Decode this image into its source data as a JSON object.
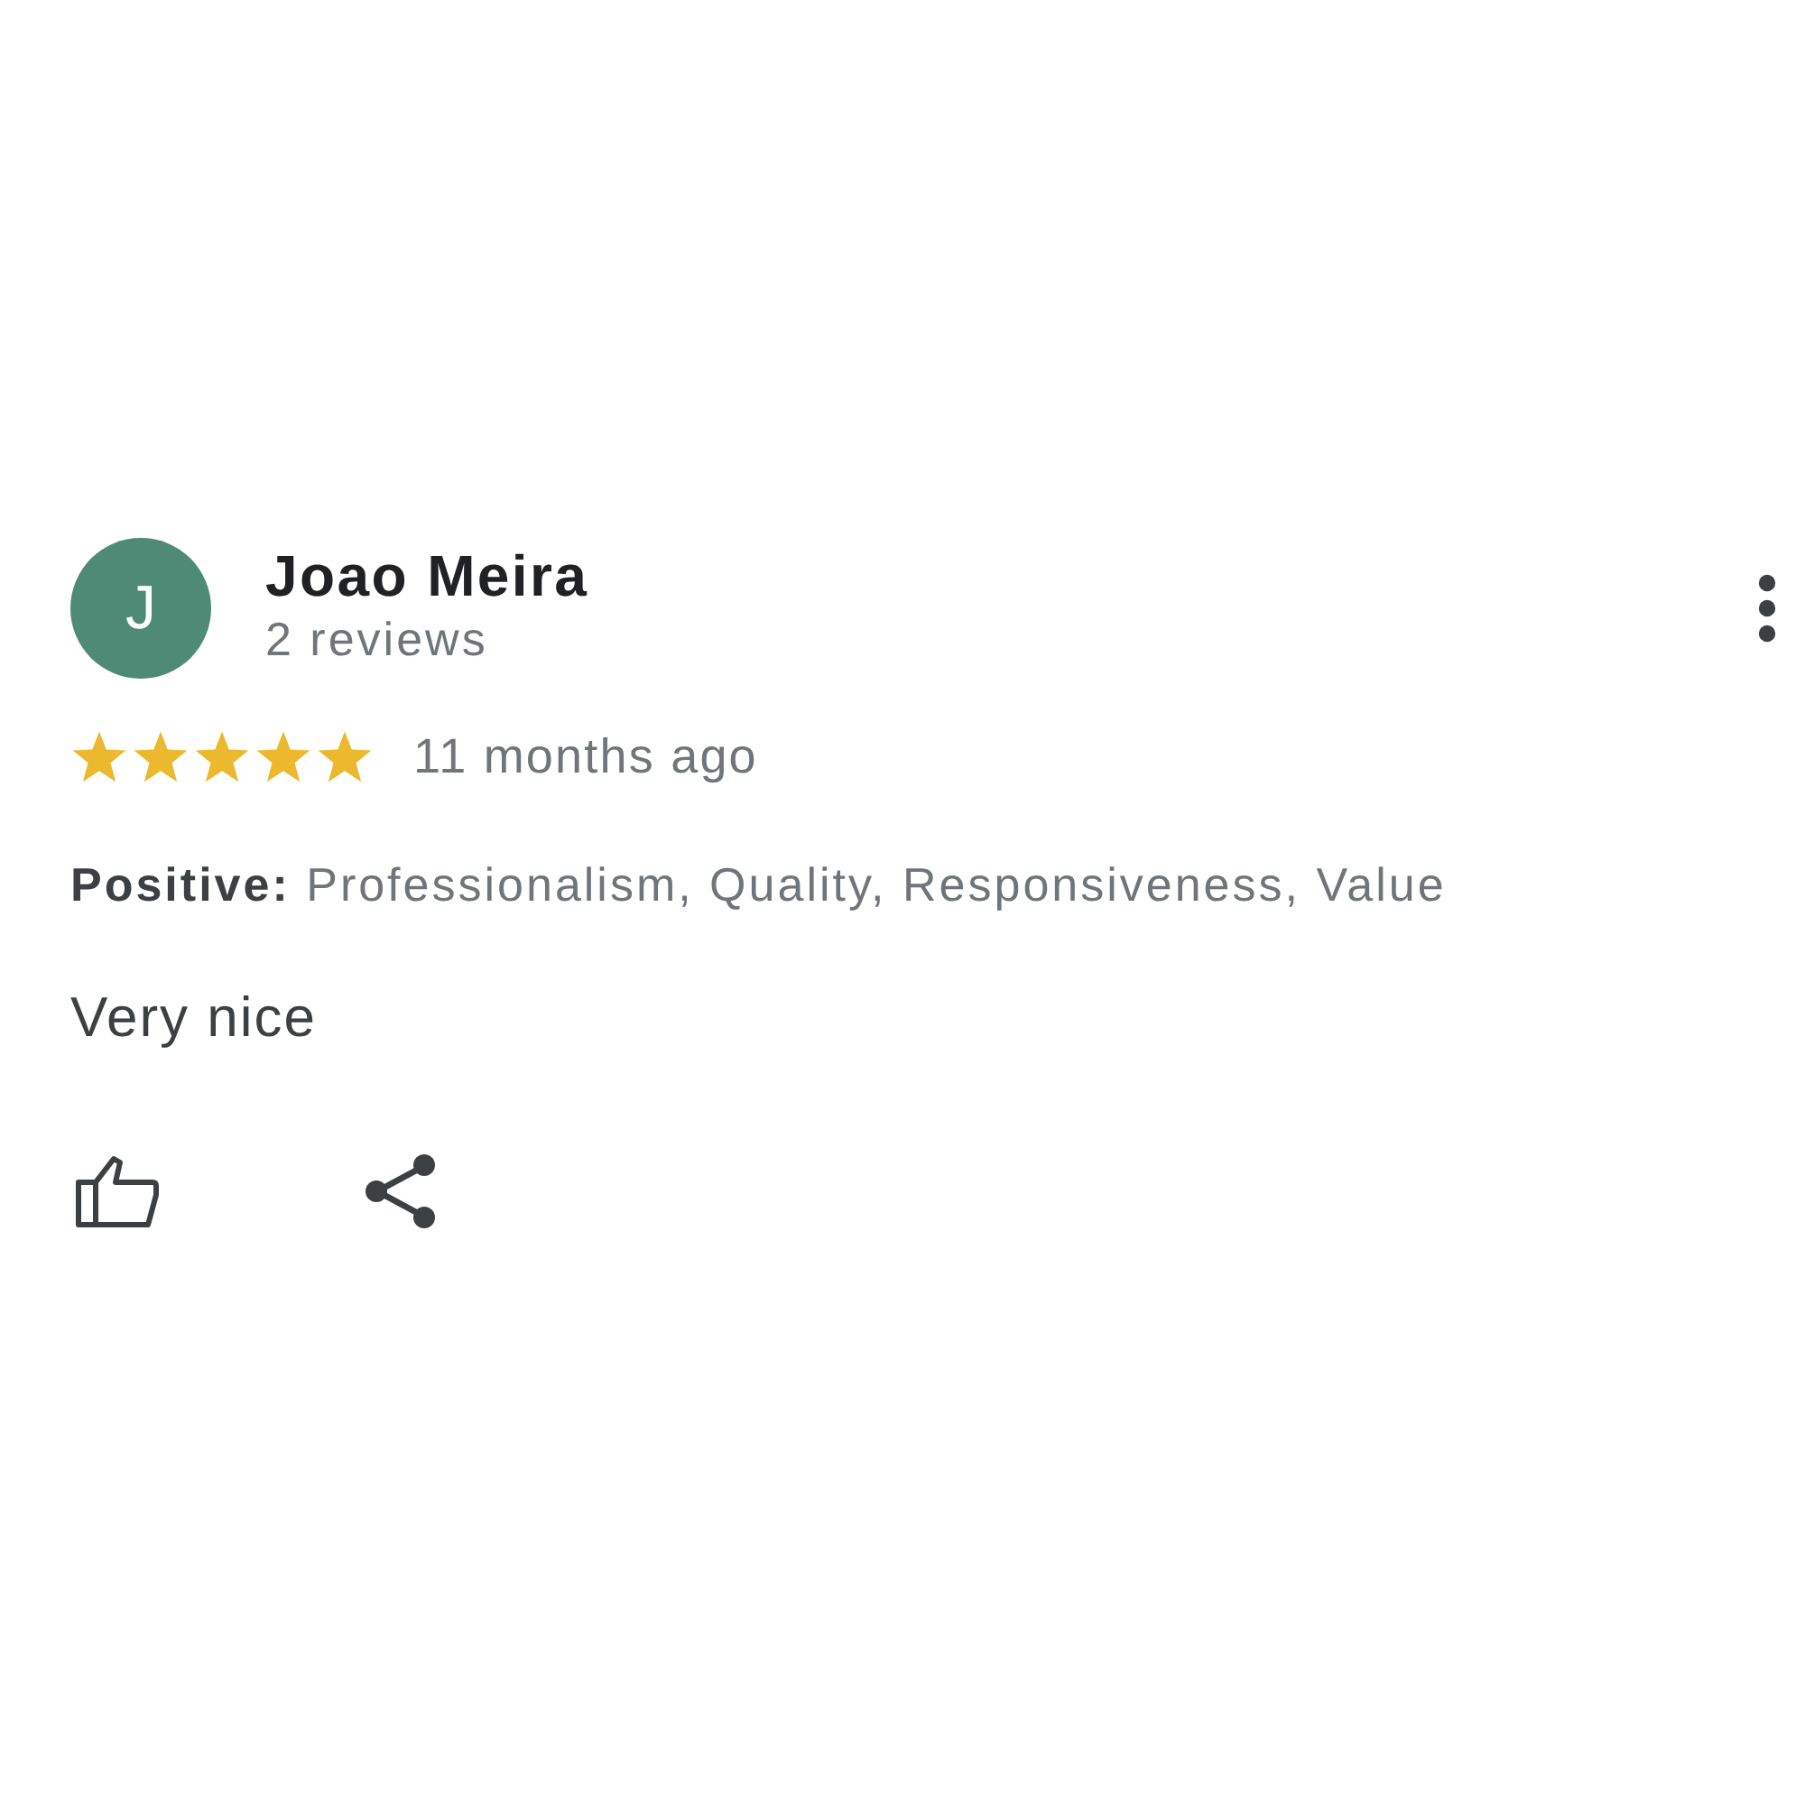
{
  "review": {
    "avatar_initial": "J",
    "author": "Joao Meira",
    "reviews_count": "2 reviews",
    "stars": 5,
    "time": "11 months ago",
    "attributes": "**Positive:** Professionalism, Quality, Responsiveness, Value",
    "text": "Very nice"
  }
}
